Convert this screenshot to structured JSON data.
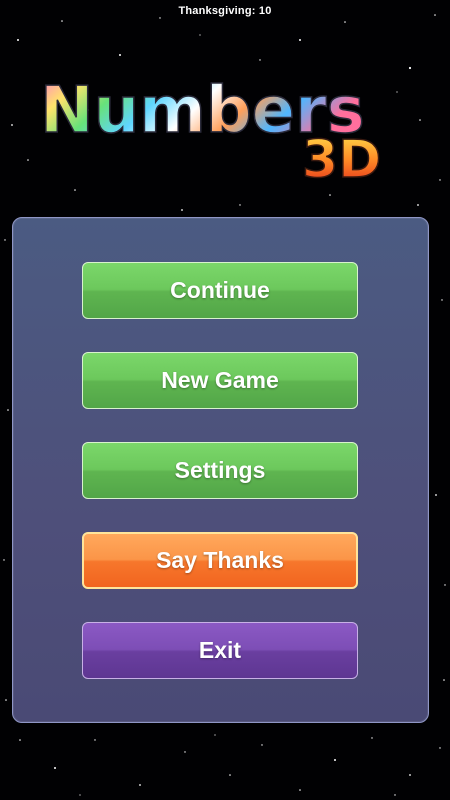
{
  "status": {
    "text": "Thanksgiving: 10"
  },
  "logo": {
    "title": "Numbers",
    "subtitle": "3D"
  },
  "menu": {
    "continue_label": "Continue",
    "new_game_label": "New Game",
    "settings_label": "Settings",
    "say_thanks_label": "Say Thanks",
    "exit_label": "Exit"
  },
  "colors": {
    "background": "#010103",
    "panel": "#4e4f7a",
    "button_green": "#6cc85c",
    "button_orange": "#f7772c",
    "button_purple": "#7d4eb6"
  }
}
